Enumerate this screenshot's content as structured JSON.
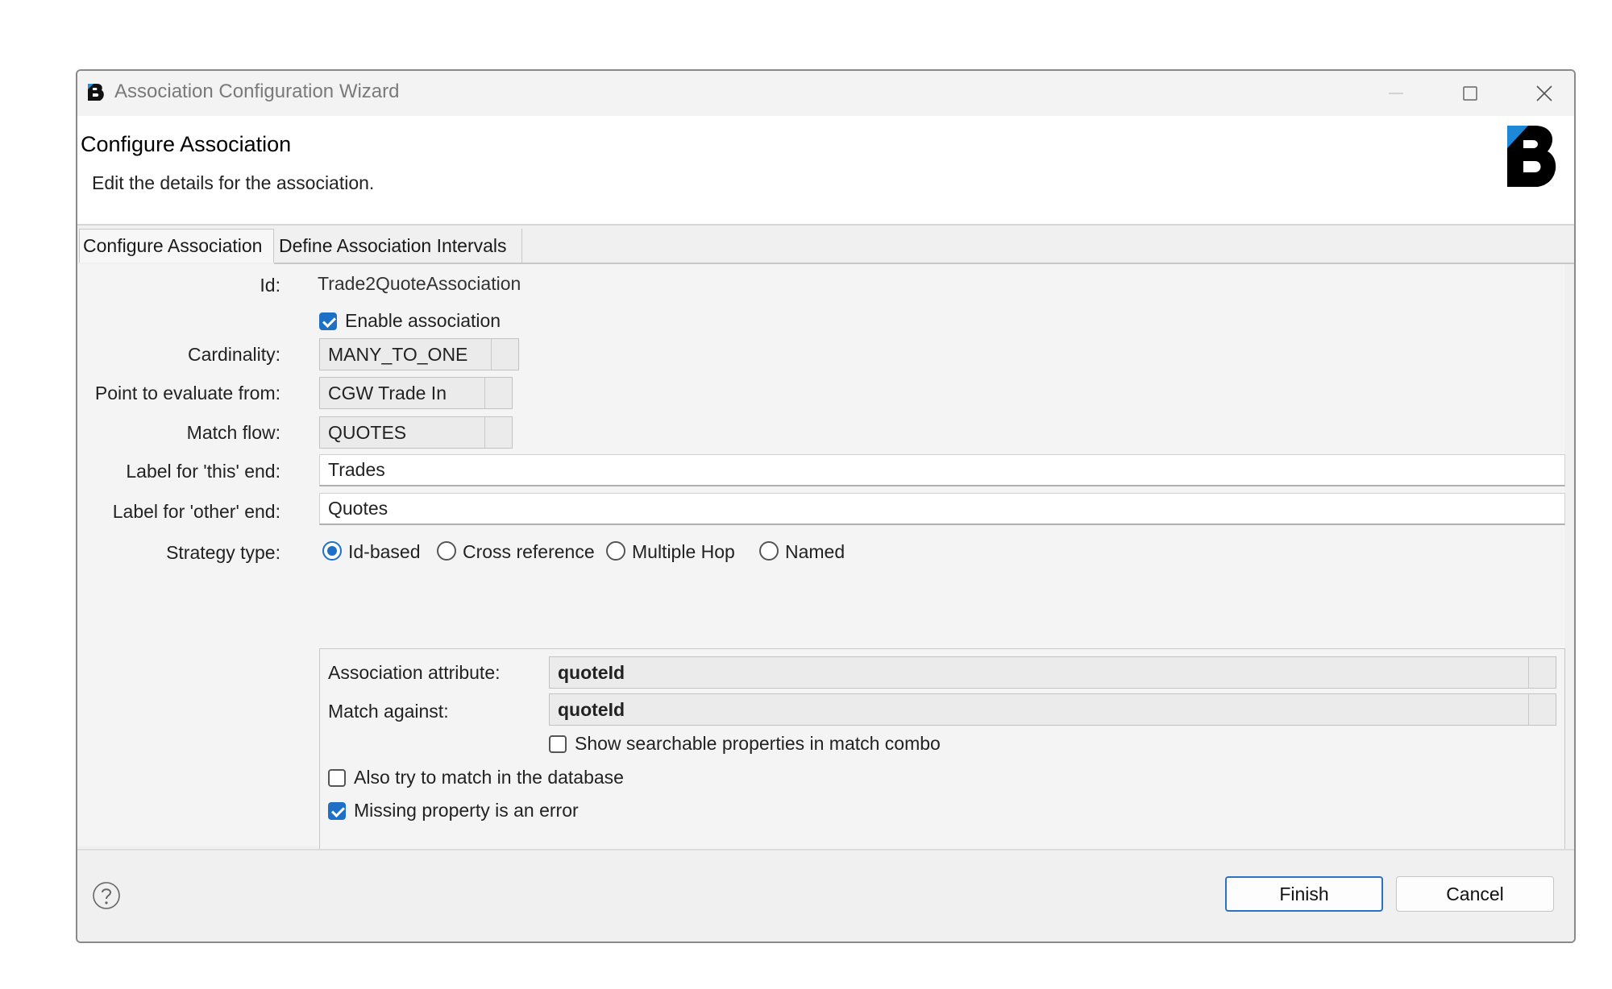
{
  "window": {
    "title": "Association Configuration Wizard"
  },
  "header": {
    "title": "Configure Association",
    "description": "Edit the details for the association."
  },
  "tabs": [
    {
      "label": "Configure Association"
    },
    {
      "label": "Define Association Intervals"
    }
  ],
  "form": {
    "id_label": "Id:",
    "id_value": "Trade2QuoteAssociation",
    "enable_label": "Enable association",
    "cardinality_label": "Cardinality:",
    "cardinality_value": "MANY_TO_ONE",
    "point_label": "Point to evaluate from:",
    "point_value": "CGW Trade In",
    "match_flow_label": "Match flow:",
    "match_flow_value": "QUOTES",
    "this_end_label": "Label for 'this' end:",
    "this_end_value": "Trades",
    "other_end_label": "Label for 'other' end:",
    "other_end_value": "Quotes",
    "strategy_label": "Strategy type:",
    "strategy_options": [
      "Id-based",
      "Cross reference",
      "Multiple Hop",
      "Named"
    ],
    "strategy_selected": "Id-based"
  },
  "strategy_group": {
    "attribute_label": "Association attribute:",
    "attribute_value": "quoteId",
    "match_against_label": "Match against:",
    "match_against_value": "quoteId",
    "show_searchable_label": "Show searchable properties in match combo",
    "db_match_label": "Also try to match in the database",
    "missing_error_label": "Missing property is an error"
  },
  "footer": {
    "finish_label": "Finish",
    "cancel_label": "Cancel"
  },
  "colors": {
    "accent": "#1e6fc6",
    "dialog_bg": "#f0f0f0"
  }
}
